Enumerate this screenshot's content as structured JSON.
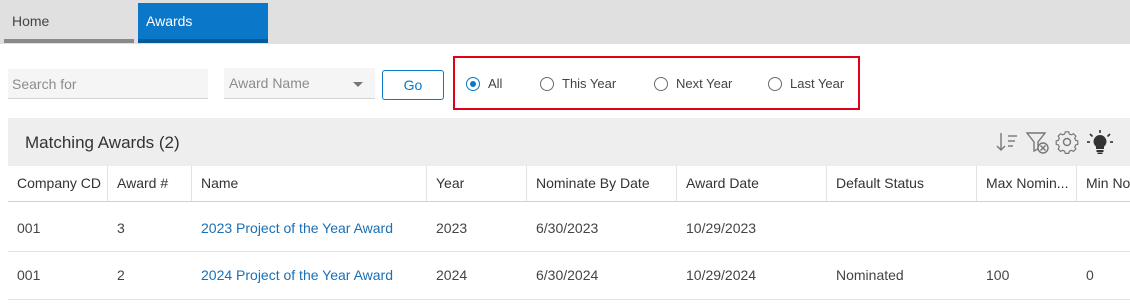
{
  "tabs": [
    {
      "label": "Home",
      "active": false
    },
    {
      "label": "Awards",
      "active": true
    }
  ],
  "search": {
    "placeholder": "Search for",
    "value": ""
  },
  "award_select": {
    "selected": "Award Name"
  },
  "go_label": "Go",
  "year_filter": {
    "selected": "All",
    "options": [
      "All",
      "This Year",
      "Next Year",
      "Last Year"
    ]
  },
  "panel": {
    "title": "Matching Awards (2)"
  },
  "toolbar_icons": [
    "sort-icon",
    "filter-clear-icon",
    "settings-icon",
    "lightbulb-icon"
  ],
  "table": {
    "columns": [
      "Company CD",
      "Award #",
      "Name",
      "Year",
      "Nominate By Date",
      "Award Date",
      "Default Status",
      "Max Nomin...",
      "Min No"
    ],
    "rows": [
      [
        "001",
        "3",
        "2023 Project of the Year Award",
        "2023",
        "6/30/2023",
        "10/29/2023",
        "",
        "",
        ""
      ],
      [
        "001",
        "2",
        "2024 Project of the Year Award",
        "2024",
        "6/30/2024",
        "10/29/2024",
        "Nominated",
        "100",
        "0"
      ]
    ]
  },
  "colors": {
    "accent": "#0a77c8",
    "highlight_box": "#e0001a",
    "link": "#1a6fb5"
  }
}
